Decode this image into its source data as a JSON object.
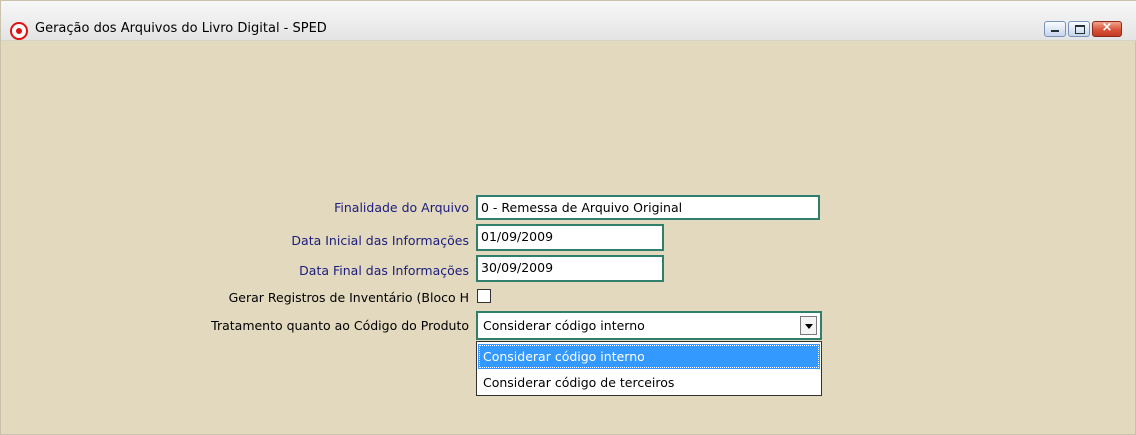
{
  "window": {
    "title": "Geração dos Arquivos do Livro Digital - SPED",
    "icon": "sped-app-icon",
    "controls": {
      "minimize": "minimize-icon",
      "maximize": "maximize-icon",
      "close": "×"
    }
  },
  "form": {
    "finalidade": {
      "label": "Finalidade do Arquivo",
      "value": "0 - Remessa de Arquivo Original"
    },
    "data_inicial": {
      "label": "Data Inicial das Informações",
      "value": "01/09/2009"
    },
    "data_final": {
      "label": "Data Final das Informações",
      "value": "30/09/2009"
    },
    "inventario": {
      "label": "Gerar Registros de Inventário (Bloco H",
      "checked": false
    },
    "tratamento": {
      "label": "Tratamento quanto ao Código do Produto",
      "selected": "Considerar código interno",
      "options": [
        "Considerar código interno",
        "Considerar código de terceiros"
      ]
    }
  },
  "colors": {
    "background": "#e2d9be",
    "label_blue": "#1c1c7c",
    "field_border": "#2f7f6c",
    "highlight": "#3399ff"
  }
}
